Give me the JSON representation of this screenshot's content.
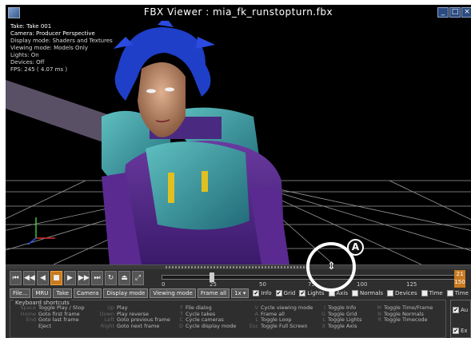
{
  "window": {
    "title": "FBX Viewer : mia_fk_runstopturn.fbx",
    "buttons": [
      "_",
      "□",
      "×"
    ]
  },
  "viewport_info": [
    "Take: Take 001",
    "Camera: Producer Perspective",
    "Display mode: Shaders and Textures",
    "Viewing mode: Models Only",
    "Lights: On",
    "Devices: Off",
    "FPS: 245 ( 4.07 ms )"
  ],
  "timeline": {
    "ticks": [
      "0",
      "25",
      "50",
      "75",
      "100",
      "125",
      "150"
    ],
    "end_top": "21",
    "end_bottom": "150",
    "position_fraction": 0.166
  },
  "toolbar": {
    "buttons": [
      "File...",
      "MRU",
      "Take",
      "Camera",
      "Display mode",
      "Viewing mode",
      "Frame all",
      "1x"
    ],
    "checkboxes": [
      {
        "label": "Info",
        "checked": true
      },
      {
        "label": "Grid",
        "checked": true
      },
      {
        "label": "Lights",
        "checked": true
      },
      {
        "label": "Axis",
        "checked": false
      },
      {
        "label": "Normals",
        "checked": false
      },
      {
        "label": "Devices",
        "checked": false
      },
      {
        "label": "Time",
        "checked": false
      },
      {
        "label": "Time",
        "checked": false
      }
    ]
  },
  "shortcuts": {
    "legend": "Keyboard shortcuts",
    "columns": [
      [
        {
          "key": "Space",
          "desc": "Toggle Play / Stop"
        },
        {
          "key": "Home",
          "desc": "Goto first frame"
        },
        {
          "key": "End",
          "desc": "Goto last frame"
        },
        {
          "key": "",
          "desc": "Eject"
        }
      ],
      [
        {
          "key": "Up",
          "desc": "Play"
        },
        {
          "key": "Down",
          "desc": "Play reverse"
        },
        {
          "key": "Left",
          "desc": "Goto previous frame"
        },
        {
          "key": "Right",
          "desc": "Goto next frame"
        }
      ],
      [
        {
          "key": "F",
          "desc": "File dialog"
        },
        {
          "key": "T",
          "desc": "Cycle takes"
        },
        {
          "key": "C",
          "desc": "Cycle cameras"
        },
        {
          "key": "D",
          "desc": "Cycle display mode"
        }
      ],
      [
        {
          "key": "V",
          "desc": "Cycle viewing mode"
        },
        {
          "key": "A",
          "desc": "Frame all"
        },
        {
          "key": "L",
          "desc": "Toggle Loop"
        },
        {
          "key": "Esc",
          "desc": "Toggle Full Screen"
        }
      ],
      [
        {
          "key": "I",
          "desc": "Toggle Info"
        },
        {
          "key": "G",
          "desc": "Toggle Grid"
        },
        {
          "key": "L",
          "desc": "Toggle Lights"
        },
        {
          "key": "X",
          "desc": "Toggle Axis"
        }
      ],
      [
        {
          "key": "M",
          "desc": "Toggle Time/Frame"
        },
        {
          "key": "N",
          "desc": "Toggle Normals"
        },
        {
          "key": "R",
          "desc": "Toggle Timecode"
        }
      ]
    ]
  },
  "right_panel": {
    "check1": "Au",
    "check2": "Ex"
  },
  "callout": {
    "label": "A"
  },
  "colors": {
    "accent": "#c87a20",
    "panel": "#2e2e2e",
    "hair": "#1f3fc8"
  }
}
